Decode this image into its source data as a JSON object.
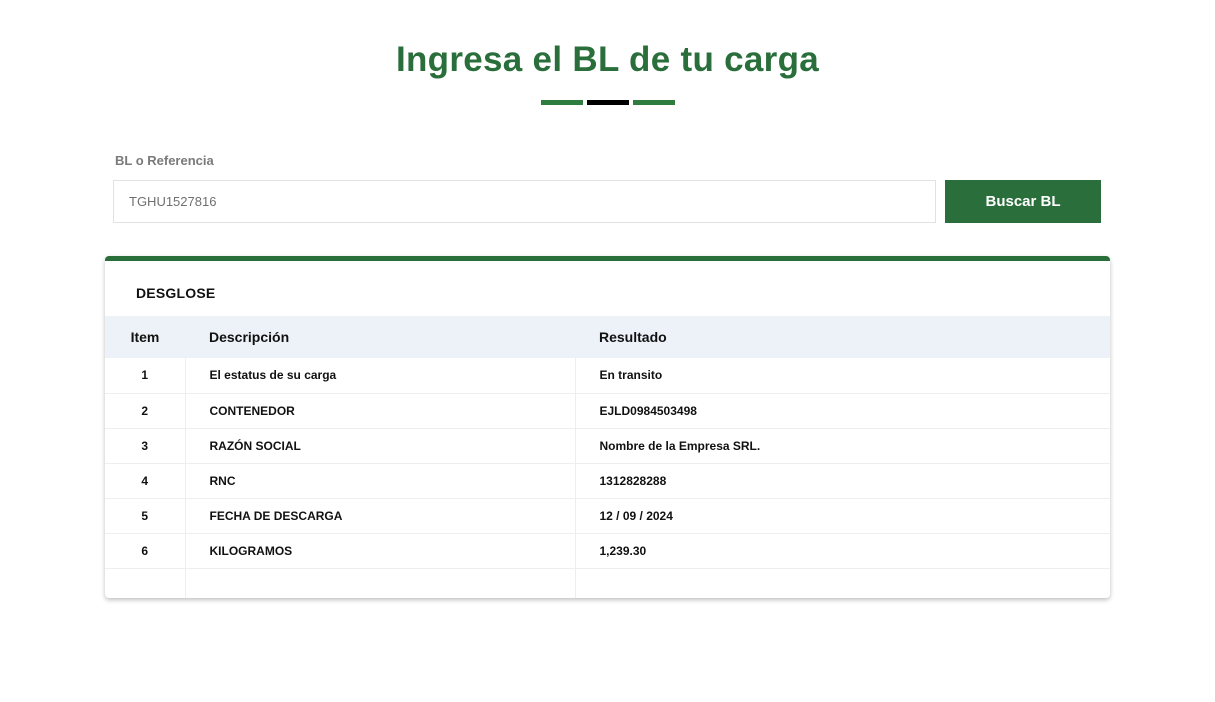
{
  "header": {
    "title": "Ingresa el BL de tu carga"
  },
  "search": {
    "label": "BL o Referencia",
    "value": "TGHU1527816",
    "button_label": "Buscar BL"
  },
  "breakdown": {
    "title": "DESGLOSE",
    "columns": [
      "Item",
      "Descripción",
      "Resultado"
    ],
    "rows": [
      {
        "item": "1",
        "description": "El estatus de su carga",
        "result": "En transito"
      },
      {
        "item": "2",
        "description": "CONTENEDOR",
        "result": "EJLD0984503498"
      },
      {
        "item": "3",
        "description": "RAZÓN SOCIAL",
        "result": "Nombre de la Empresa SRL."
      },
      {
        "item": "4",
        "description": "RNC",
        "result": "1312828288"
      },
      {
        "item": "5",
        "description": "FECHA DE DESCARGA",
        "result": "12 / 09 / 2024"
      },
      {
        "item": "6",
        "description": "KILOGRAMOS",
        "result": "1,239.30"
      }
    ]
  },
  "colors": {
    "accent": "#2a6f3b",
    "table_header_bg": "#edf2f8"
  }
}
